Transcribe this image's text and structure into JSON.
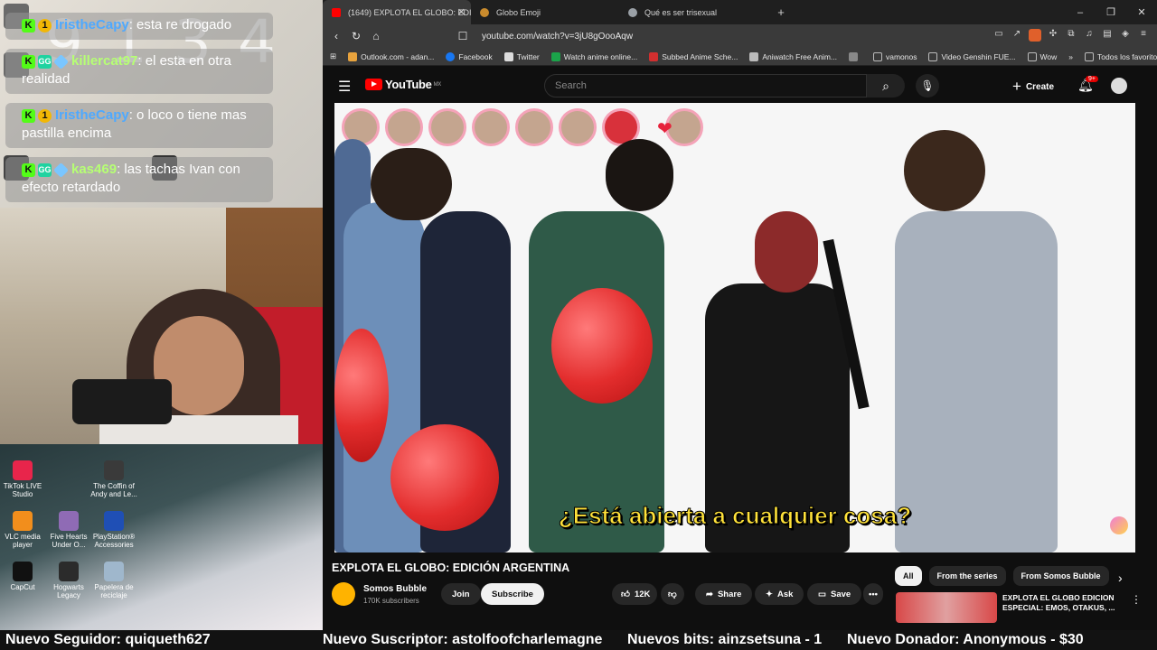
{
  "stream": {
    "clock_bg": "9 1 3 4",
    "chat": [
      {
        "user": "IristheCapy",
        "text": ": esta re drogado",
        "color": "#4ea9ff"
      },
      {
        "user": "killercat97",
        "text": ": el esta en otra realidad",
        "color": "#b6ff74"
      },
      {
        "user": "IristheCapy",
        "text": ": o loco o tiene mas pastilla encima",
        "color": "#4ea9ff"
      },
      {
        "user": "kas469",
        "text": ": las tachas Ivan con efecto retardado",
        "color": "#b6ff74"
      }
    ],
    "desktop_icons": [
      {
        "label": "TikTok LIVE Studio",
        "color": "#e8254b"
      },
      {
        "label": "The Coffin of Andy and Le...",
        "color": "#3a3a3a"
      },
      {
        "label": "VLC media player",
        "color": "#f28e1c"
      },
      {
        "label": "Five Hearts Under O...",
        "color": "#8f6bb5"
      },
      {
        "label": "PlayStation® Accessories",
        "color": "#1f4fb5"
      },
      {
        "label": "CapCut",
        "color": "#111111"
      },
      {
        "label": "Hogwarts Legacy",
        "color": "#2b2b2b"
      },
      {
        "label": "Papelera de reciclaje",
        "color": "#9fb7cc"
      }
    ]
  },
  "browser": {
    "tabs": [
      {
        "title": "(1649) EXPLOTA EL GLOBO: EDI",
        "color": "#ff0000",
        "active": true
      },
      {
        "title": "Globo Emoji",
        "color": "#c98b2d",
        "active": false
      },
      {
        "title": "Qué es ser trisexual",
        "color": "#9aa0a6",
        "active": false
      }
    ],
    "window_controls": [
      "–",
      "❐",
      "✕"
    ],
    "url": "youtube.com/watch?v=3jU8gOooAqw",
    "bookmarks": [
      {
        "label": "Outlook.com - adan...",
        "color": "#e8a33d"
      },
      {
        "label": "Facebook",
        "color": "#1877f2"
      },
      {
        "label": "Twitter",
        "color": "#dddddd"
      },
      {
        "label": "Watch anime online...",
        "color": "#1ba34a"
      },
      {
        "label": "Subbed Anime Sche...",
        "color": "#d12f2f"
      },
      {
        "label": "Aniwatch Free Anim...",
        "color": "#bbbbbb"
      },
      {
        "label": "",
        "color": "#888888"
      },
      {
        "label": "vamonos",
        "color": "#777777"
      },
      {
        "label": "Video Genshin FUE...",
        "color": "#777777"
      },
      {
        "label": "Wow",
        "color": "#777777"
      },
      {
        "label": "»",
        "color": "#3a3a3a"
      },
      {
        "label": "Todos los favoritos",
        "color": "#777777"
      }
    ]
  },
  "youtube": {
    "logo": "YouTube",
    "region": "MX",
    "search_placeholder": "Search",
    "create_label": "Create",
    "notif_count": "9+",
    "subtitle": "¿Está abierta a cualquier cosa?",
    "video_title": "EXPLOTA EL GLOBO: EDICIÓN ARGENTINA",
    "channel_name": "Somos Bubble",
    "channel_subs": "170K subscribers",
    "join_label": "Join",
    "subscribe_label": "Subscribe",
    "likes": "12K",
    "share_label": "Share",
    "ask_label": "Ask",
    "save_label": "Save",
    "filters": [
      "All",
      "From the series",
      "From Somos Bubble"
    ],
    "recommended_title": "EXPLOTA EL GLOBO EDICION ESPECIAL: EMOS, OTAKUS, ..."
  },
  "ticker": {
    "follower": "Nuevo Seguidor: quiqueth627",
    "subscriber": "Nuevo Suscriptor: astolfoofcharlemagne",
    "bits": "Nuevos bits: ainzsetsuna - 1",
    "donor": "Nuevo Donador: Anonymous - $30"
  }
}
